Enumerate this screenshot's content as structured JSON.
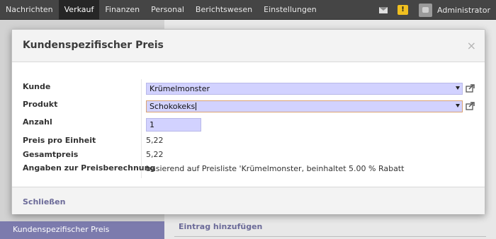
{
  "topnav": {
    "items": [
      {
        "label": "Nachrichten",
        "active": false
      },
      {
        "label": "Verkauf",
        "active": true
      },
      {
        "label": "Finanzen",
        "active": false
      },
      {
        "label": "Personal",
        "active": false
      },
      {
        "label": "Berichtswesen",
        "active": false
      },
      {
        "label": "Einstellungen",
        "active": false
      }
    ],
    "warning_glyph": "!",
    "user_name": "Administrator"
  },
  "background": {
    "sidebar_active_label": "Kundenspezifischer Preis",
    "add_entry_label": "Eintrag hinzufügen"
  },
  "modal": {
    "title": "Kundenspezifischer Preis",
    "close_symbol": "×",
    "fields": {
      "kunde": {
        "label": "Kunde",
        "value": "Krümelmonster"
      },
      "produkt": {
        "label": "Produkt",
        "value": "Schokokeks"
      },
      "anzahl": {
        "label": "Anzahl",
        "value": "1"
      },
      "preis_pro_einheit": {
        "label": "Preis pro Einheit",
        "value": "5,22"
      },
      "gesamtpreis": {
        "label": "Gesamtpreis",
        "value": "5,22"
      },
      "angaben": {
        "label": "Angaben zur Preisberechnung",
        "value": "basierend auf Preisliste 'Krümelmonster, beinhaltet 5.00 % Rabatt"
      }
    },
    "footer": {
      "close_label": "Schließen"
    }
  },
  "colors": {
    "topbar": "#454545",
    "field_background": "#d2d2ff",
    "accent_link": "#6b6a98",
    "sidebar_active": "#7c7bad"
  },
  "icons": [
    "mail-icon",
    "warning-icon",
    "avatar-icon",
    "external-link-icon",
    "dropdown-arrow-icon",
    "close-icon"
  ]
}
